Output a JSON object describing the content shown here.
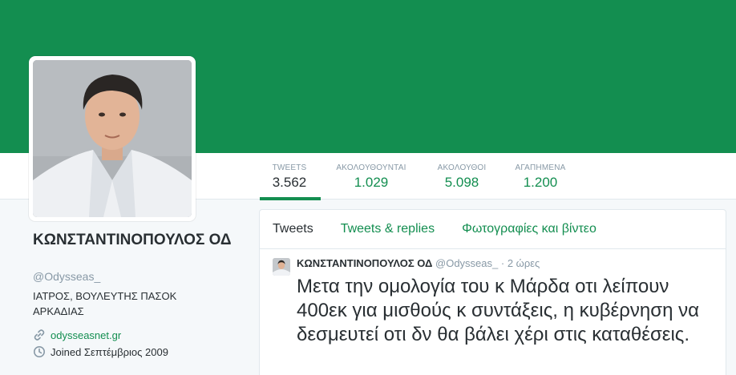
{
  "colors": {
    "brand": "#138e50",
    "text": "#292f33",
    "muted": "#8899a6",
    "background": "#f5f8fa"
  },
  "stats": [
    {
      "label": "TWEETS",
      "value": "3.562",
      "active": true
    },
    {
      "label": "ΑΚΟΛΟΥΘΟΥΝΤΑΙ",
      "value": "1.029",
      "active": false
    },
    {
      "label": "ΑΚΟΛΟΥΘΟΙ",
      "value": "5.098",
      "active": false
    },
    {
      "label": "ΑΓΑΠΗΜΕΝΑ",
      "value": "1.200",
      "active": false
    }
  ],
  "profile": {
    "name": "ΚΩΝΣΤΑΝΤΙΝΟΠΟΥΛΟΣ ΟΔ",
    "handle": "@Odysseas_",
    "bio": "ΙΑΤΡΟΣ, ΒΟΥΛΕΥΤΗΣ ΠΑΣΟΚ ΑΡΚΑΔΙΑΣ",
    "link_icon": "link-icon",
    "website": "odysseasnet.gr",
    "joined_icon": "calendar-icon",
    "joined": "Joined Σεπτέμβριος 2009"
  },
  "tabs": [
    {
      "label": "Tweets",
      "active": true
    },
    {
      "label": "Tweets & replies",
      "active": false
    },
    {
      "label": "Φωτογραφίες και βίντεο",
      "active": false
    }
  ],
  "tweet": {
    "author": "ΚΩΝΣΤΑΝΤΙΝΟΠΟΥΛΟΣ ΟΔ",
    "handle": "@Odysseas_",
    "separator": "·",
    "time": "2 ώρες",
    "text": "Μετα την ομολογία του κ Μάρδα οτι λείπουν 400εκ για μισθούς κ συντάξεις, η κυβέρνηση να δεσμευτεί οτι δν θα βάλει χέρι στις καταθέσεις."
  }
}
